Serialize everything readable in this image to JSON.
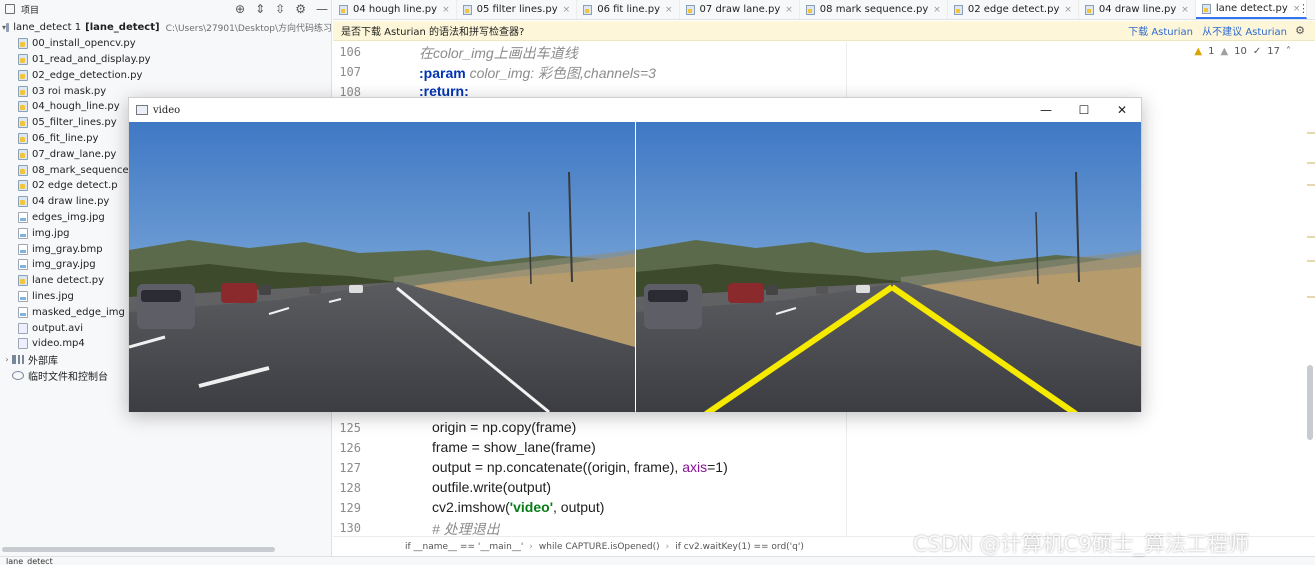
{
  "project_panel": {
    "title": "项目",
    "tool_icons": [
      "target-icon",
      "expand-all-icon",
      "collapse-all-icon",
      "gear-icon",
      "minimize-icon"
    ],
    "root": {
      "name": "lane_detect 1",
      "module": "[lane_detect]",
      "path": "C:\\Users\\27901\\Desktop\\方向代码练习"
    },
    "files": [
      {
        "name": "00_install_opencv.py",
        "kind": "py"
      },
      {
        "name": "01_read_and_display.py",
        "kind": "py"
      },
      {
        "name": "02_edge_detection.py",
        "kind": "py"
      },
      {
        "name": "03 roi mask.py",
        "kind": "py"
      },
      {
        "name": "04_hough_line.py",
        "kind": "py"
      },
      {
        "name": "05_filter_lines.py",
        "kind": "py"
      },
      {
        "name": "06_fit_line.py",
        "kind": "py"
      },
      {
        "name": "07_draw_lane.py",
        "kind": "py"
      },
      {
        "name": "08_mark_sequence",
        "kind": "py"
      },
      {
        "name": "02 edge detect.p",
        "kind": "py"
      },
      {
        "name": "04 draw line.py",
        "kind": "py"
      },
      {
        "name": "edges_img.jpg",
        "kind": "img"
      },
      {
        "name": "img.jpg",
        "kind": "img"
      },
      {
        "name": "img_gray.bmp",
        "kind": "img"
      },
      {
        "name": "img_gray.jpg",
        "kind": "img"
      },
      {
        "name": "lane detect.py",
        "kind": "py"
      },
      {
        "name": "lines.jpg",
        "kind": "img"
      },
      {
        "name": "masked_edge_img",
        "kind": "img"
      },
      {
        "name": "output.avi",
        "kind": "vid"
      },
      {
        "name": "video.mp4",
        "kind": "vid"
      }
    ],
    "external_libs": "外部库",
    "scratches": "临时文件和控制台"
  },
  "tabs": [
    {
      "label": "04 hough line.py",
      "active": false
    },
    {
      "label": "05 filter lines.py",
      "active": false
    },
    {
      "label": "06 fit line.py",
      "active": false
    },
    {
      "label": "07 draw lane.py",
      "active": false
    },
    {
      "label": "08 mark sequence.py",
      "active": false
    },
    {
      "label": "02 edge detect.py",
      "active": false
    },
    {
      "label": "04 draw line.py",
      "active": false
    },
    {
      "label": "lane detect.py",
      "active": true
    }
  ],
  "banner": {
    "text": "是否下载 Asturian 的语法和拼写检查器?",
    "download": "下载 Asturian",
    "ignore": "从不建议 Asturian"
  },
  "inspections": {
    "warnings": "1",
    "weak": "10",
    "typos": "17"
  },
  "code_top": [
    {
      "line": "106",
      "text": "在color_img上画出车道线"
    },
    {
      "line": "107",
      "kw": ":param",
      "text": " color_img: 彩色图,channels=3"
    },
    {
      "line": "108",
      "kw": ":return:",
      "text": ""
    }
  ],
  "code_bottom": [
    {
      "line": "125",
      "text": "origin = np.copy(frame)"
    },
    {
      "line": "126",
      "text": "frame = show_lane(frame)"
    },
    {
      "line": "127",
      "text_a": "output = np.concatenate((origin, frame), ",
      "kwarg": "axis",
      "text_b": "=1)"
    },
    {
      "line": "128",
      "text": "outfile.write(output)"
    },
    {
      "line": "129",
      "text_a": "cv2.imshow(",
      "str": "'video'",
      "text_b": ", output)"
    },
    {
      "line": "130",
      "text": "# 处理退出"
    }
  ],
  "breadcrumbs": [
    "if __name__ == '__main__'",
    "while CAPTURE.isOpened()",
    "if cv2.waitKey(1) == ord('q')"
  ],
  "status": {
    "text": "lane_detect"
  },
  "video_window": {
    "title": "video",
    "buttons": [
      "minimize-button",
      "maximize-button",
      "close-button"
    ]
  },
  "watermark": "CSDN @计算机C9硕士_算法工程师",
  "colors": {
    "lane": "#f5ea00",
    "accent": "#3574f0",
    "banner": "#fdf6d8"
  }
}
